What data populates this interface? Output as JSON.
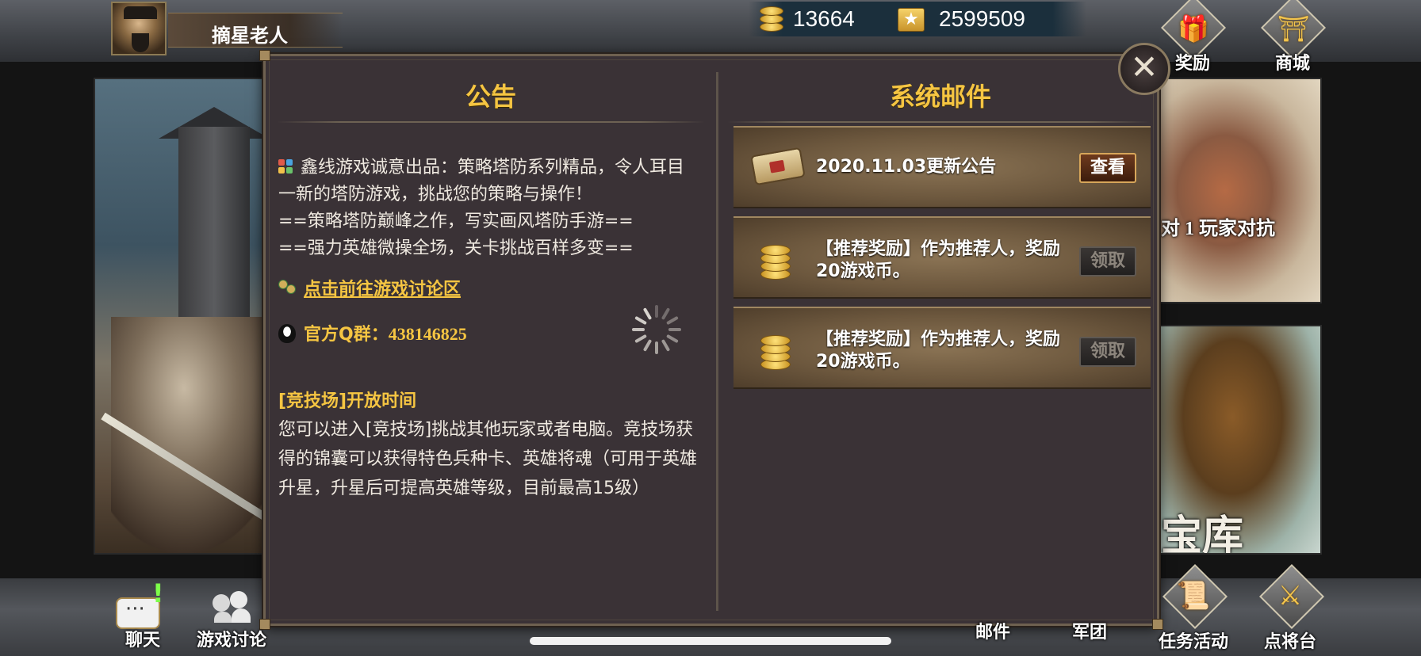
{
  "player": {
    "name": "摘星老人",
    "coins": "13664",
    "stars": "2599509"
  },
  "top_nav": {
    "reward_label": "奖励",
    "shop_label": "商城"
  },
  "background": {
    "pvp_caption": "对 1 玩家对抗",
    "treasure_caption": "宝库"
  },
  "dialog": {
    "announcement": {
      "title": "公告",
      "intro": "鑫线游戏诚意出品：策略塔防系列精品，令人耳目一新的塔防游戏，挑战您的策略与操作！",
      "line1": "==策略塔防巅峰之作，写实画风塔防手游==",
      "line2": "==强力英雄微操全场，关卡挑战百样多变==",
      "forum_link": "点击前往游戏讨论区",
      "qq_label": "官方Q群：",
      "qq_number": "438146825",
      "arena_heading": "[竞技场]开放时间",
      "arena_body": "您可以进入[竞技场]挑战其他玩家或者电脑。竞技场获得的锦囊可以获得特色兵种卡、英雄将魂（可用于英雄升星，升星后可提高英雄等级，目前最高15级）"
    },
    "mail": {
      "title": "系统邮件",
      "items": [
        {
          "icon": "scroll-icon",
          "text": "2020.11.03更新公告",
          "button": "查看",
          "button_state": "active"
        },
        {
          "icon": "coins-icon",
          "text": "【推荐奖励】作为推荐人，奖励20游戏币。",
          "button": "领取",
          "button_state": "disabled"
        },
        {
          "icon": "coins-icon",
          "text": "【推荐奖励】作为推荐人，奖励20游戏币。",
          "button": "领取",
          "button_state": "disabled"
        }
      ]
    },
    "close_symbol": "✕"
  },
  "bottom_nav": {
    "chat_label": "聊天",
    "discuss_label": "游戏讨论",
    "mail_label": "邮件",
    "guild_label": "军团",
    "event_label": "任务活动",
    "arena_label": "点将台"
  },
  "colors": {
    "accent_gold": "#f5c542",
    "dialog_bg": "#3a3236",
    "mail_card": "#6d583e"
  }
}
